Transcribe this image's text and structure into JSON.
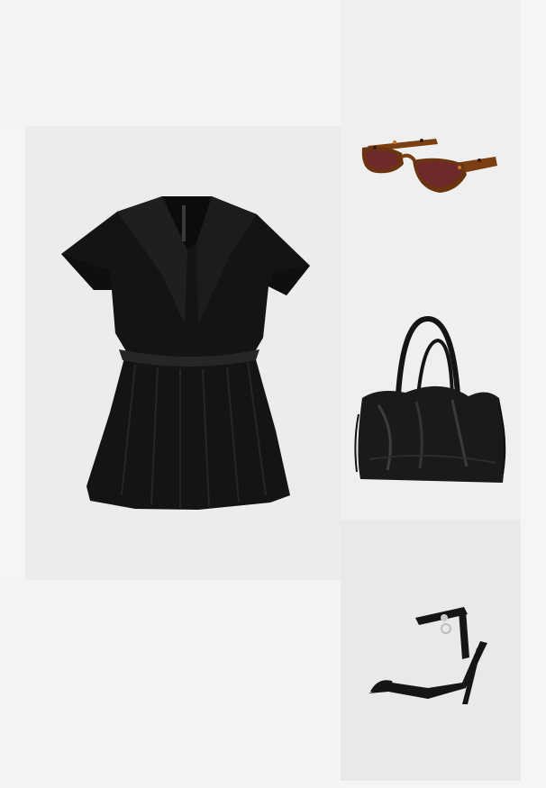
{
  "outfit": {
    "items": [
      {
        "id": "dress",
        "name": "black-tunic-dress"
      },
      {
        "id": "sunglasses",
        "name": "tortoiseshell-cat-eye-sunglasses"
      },
      {
        "id": "bag",
        "name": "black-leather-shoulder-bag"
      },
      {
        "id": "sandal",
        "name": "black-strappy-heel-sandal"
      }
    ]
  },
  "colors": {
    "dress": "#141414",
    "tortoise": "#7a3e12",
    "lens": "#6e2a2a",
    "bag": "#1a1a1a",
    "sandal": "#151515"
  }
}
